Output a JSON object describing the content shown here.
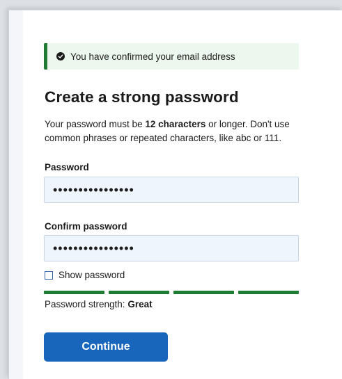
{
  "banner": {
    "message": "You have confirmed your email address",
    "icon": "check-circle-icon",
    "accent_color": "#1e7b34"
  },
  "heading": "Create a strong password",
  "description": {
    "part1": "Your password must be ",
    "emphasis": "12 characters",
    "part2": " or longer. Don't use common phrases or repeated characters, like abc or 111."
  },
  "password": {
    "label": "Password",
    "value": "••••••••••••••••"
  },
  "confirm_password": {
    "label": "Confirm password",
    "value": "••••••••••••••••"
  },
  "show_password": {
    "label": "Show password",
    "checked": false
  },
  "strength": {
    "label": "Password strength: ",
    "value": "Great",
    "filled_segments": 4,
    "total_segments": 4,
    "color": "#1e7b34"
  },
  "continue_button": {
    "label": "Continue",
    "color": "#1866bc"
  }
}
